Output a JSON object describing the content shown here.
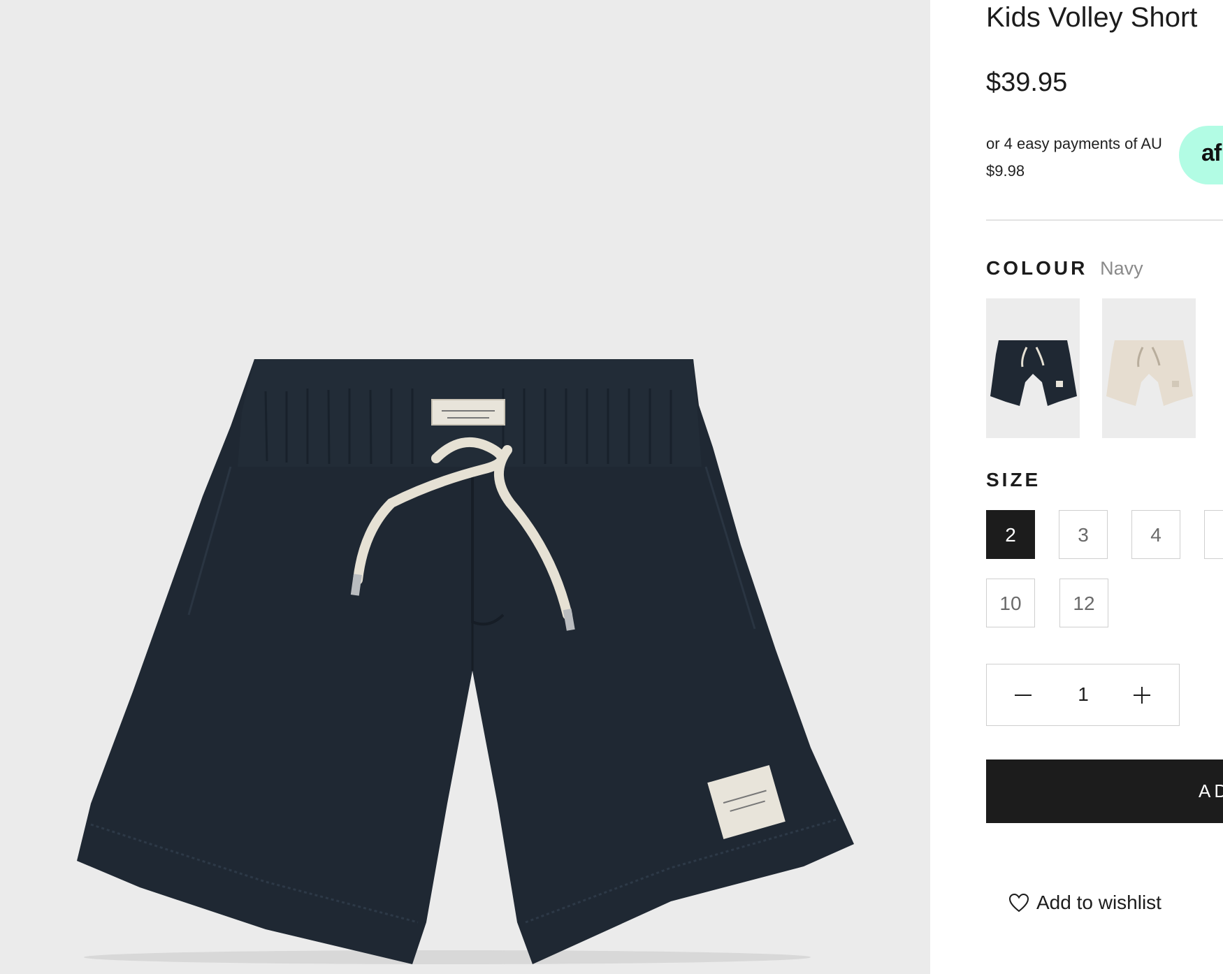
{
  "product": {
    "title": "Kids Volley Short",
    "price": "$39.95",
    "afterpay": {
      "text": "or 4 easy payments of AU $9.98",
      "badge": "af",
      "badge_color": "#b2fce4"
    }
  },
  "colour": {
    "label": "COLOUR",
    "selected": "Navy",
    "swatches": [
      {
        "name": "Navy",
        "color": "#1f2833"
      },
      {
        "name": "Sand",
        "color": "#e6ddd0"
      }
    ]
  },
  "size": {
    "label": "SIZE",
    "options": [
      "2",
      "3",
      "4",
      "",
      "10",
      "12"
    ],
    "selected": "2"
  },
  "quantity": {
    "value": "1"
  },
  "cart": {
    "label": "AD"
  },
  "wishlist": {
    "label": "Add to wishlist",
    "icon": "heart-icon"
  },
  "colors": {
    "dark": "#1c1c1c",
    "image_bg": "#ebebeb",
    "navy": "#1f2833"
  }
}
